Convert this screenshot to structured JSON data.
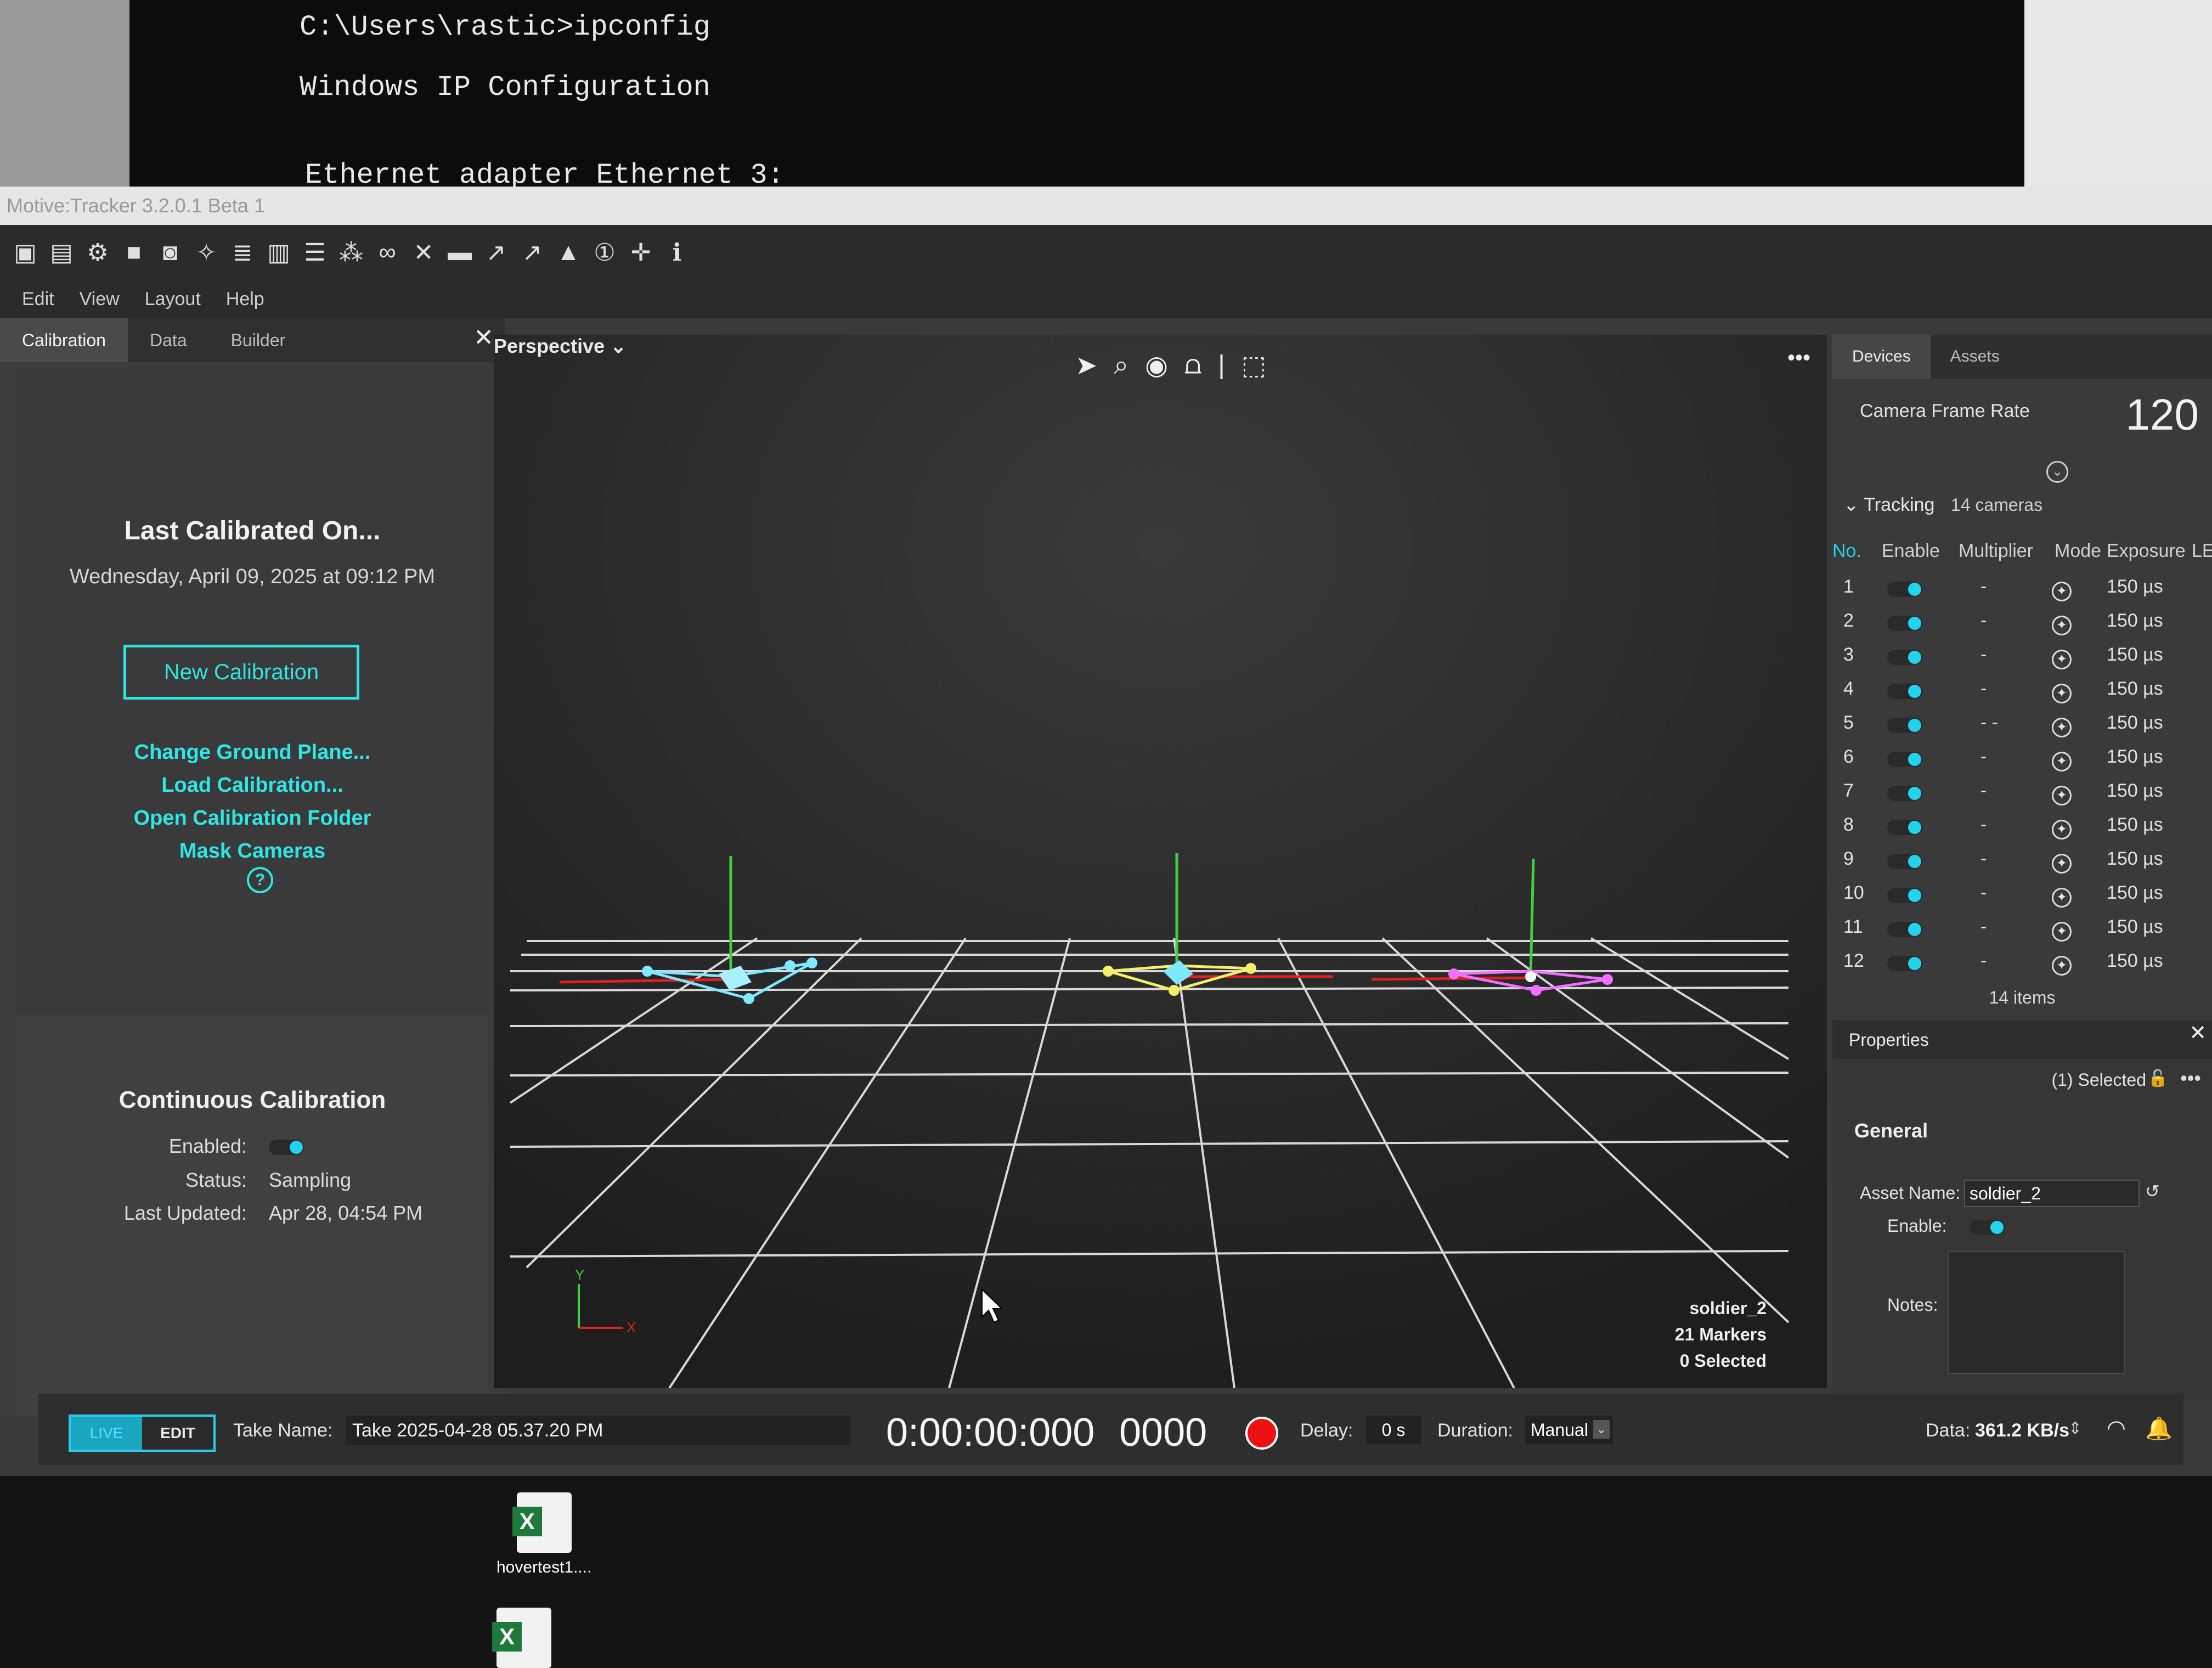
{
  "terminal": {
    "lines": [
      "C:\\Users\\rastic>ipconfig",
      "Windows IP Configuration",
      "Ethernet adapter Ethernet 3:"
    ]
  },
  "window": {
    "title": "Motive:Tracker 3.2.0.1 Beta 1"
  },
  "menu": [
    "Edit",
    "View",
    "Layout",
    "Help"
  ],
  "left_panel": {
    "tabs": [
      "Calibration",
      "Data",
      "Builder"
    ],
    "last_calibrated_title": "Last Calibrated On...",
    "last_calibrated_date": "Wednesday, April 09, 2025 at 09:12 PM",
    "new_calibration": "New Calibration",
    "links": [
      "Change Ground Plane...",
      "Load Calibration...",
      "Open Calibration Folder",
      "Mask Cameras"
    ],
    "help": "?",
    "continuous": {
      "title": "Continuous Calibration",
      "enabled_label": "Enabled:",
      "enabled": true,
      "status_label": "Status:",
      "status": "Sampling",
      "updated_label": "Last Updated:",
      "updated": "Apr 28, 04:54 PM"
    }
  },
  "viewport": {
    "view_mode": "Perspective",
    "more": "•••",
    "asset_name": "soldier_2",
    "markers": "21 Markers",
    "selected": "0 Selected",
    "axis_y": "Y",
    "axis_x": "X"
  },
  "right_panel": {
    "tabs": [
      "Devices",
      "Assets"
    ],
    "camera_frame_rate_label": "Camera Frame Rate",
    "camera_frame_rate": "120",
    "tracking_label": "Tracking",
    "tracking_count": "14 cameras",
    "columns": [
      "No.",
      "Enable",
      "Multiplier",
      "Mode",
      "Exposure",
      "LE"
    ],
    "cameras": [
      {
        "no": "1",
        "multiplier": "-",
        "exposure": "150 µs"
      },
      {
        "no": "2",
        "multiplier": "-",
        "exposure": "150 µs"
      },
      {
        "no": "3",
        "multiplier": "-",
        "exposure": "150 µs"
      },
      {
        "no": "4",
        "multiplier": "-",
        "exposure": "150 µs"
      },
      {
        "no": "5",
        "multiplier": "- -",
        "exposure": "150 µs"
      },
      {
        "no": "6",
        "multiplier": "-",
        "exposure": "150 µs"
      },
      {
        "no": "7",
        "multiplier": "-",
        "exposure": "150 µs"
      },
      {
        "no": "8",
        "multiplier": "-",
        "exposure": "150 µs"
      },
      {
        "no": "9",
        "multiplier": "-",
        "exposure": "150 µs"
      },
      {
        "no": "10",
        "multiplier": "-",
        "exposure": "150 µs"
      },
      {
        "no": "11",
        "multiplier": "-",
        "exposure": "150 µs"
      },
      {
        "no": "12",
        "multiplier": "-",
        "exposure": "150 µs"
      }
    ],
    "items_count": "14 items",
    "properties": {
      "title": "Properties",
      "selected": "(1) Selected",
      "general": "General",
      "asset_name_label": "Asset Name:",
      "asset_name": "soldier_2",
      "enable_label": "Enable:",
      "notes_label": "Notes:"
    }
  },
  "status_bar": {
    "live": "LIVE",
    "edit": "EDIT",
    "take_name_label": "Take Name:",
    "take_name": "Take 2025-04-28 05.37.20 PM",
    "timecode": "0:00:00:000",
    "frame": "0000",
    "delay_label": "Delay:",
    "delay": "0 s",
    "duration_label": "Duration:",
    "duration": "Manual",
    "data_label": "Data:",
    "data_rate": "361.2 KB/s"
  },
  "desktop": {
    "file1": "hovertest1...."
  },
  "colors": {
    "accent_cyan": "#2ee6e6",
    "record_red": "#e11111",
    "marker_cyan": "#7fe8ff",
    "marker_yellow": "#f4f06a",
    "marker_magenta": "#f070ff"
  }
}
